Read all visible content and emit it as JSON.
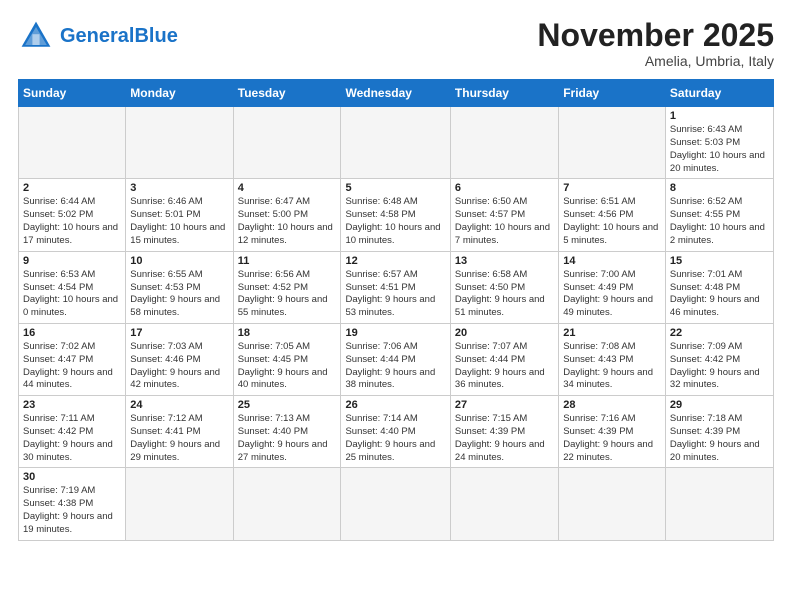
{
  "header": {
    "logo_general": "General",
    "logo_blue": "Blue",
    "month_title": "November 2025",
    "subtitle": "Amelia, Umbria, Italy"
  },
  "days_of_week": [
    "Sunday",
    "Monday",
    "Tuesday",
    "Wednesday",
    "Thursday",
    "Friday",
    "Saturday"
  ],
  "weeks": [
    [
      {
        "day": "",
        "info": ""
      },
      {
        "day": "",
        "info": ""
      },
      {
        "day": "",
        "info": ""
      },
      {
        "day": "",
        "info": ""
      },
      {
        "day": "",
        "info": ""
      },
      {
        "day": "",
        "info": ""
      },
      {
        "day": "1",
        "info": "Sunrise: 6:43 AM\nSunset: 5:03 PM\nDaylight: 10 hours and 20 minutes."
      }
    ],
    [
      {
        "day": "2",
        "info": "Sunrise: 6:44 AM\nSunset: 5:02 PM\nDaylight: 10 hours and 17 minutes."
      },
      {
        "day": "3",
        "info": "Sunrise: 6:46 AM\nSunset: 5:01 PM\nDaylight: 10 hours and 15 minutes."
      },
      {
        "day": "4",
        "info": "Sunrise: 6:47 AM\nSunset: 5:00 PM\nDaylight: 10 hours and 12 minutes."
      },
      {
        "day": "5",
        "info": "Sunrise: 6:48 AM\nSunset: 4:58 PM\nDaylight: 10 hours and 10 minutes."
      },
      {
        "day": "6",
        "info": "Sunrise: 6:50 AM\nSunset: 4:57 PM\nDaylight: 10 hours and 7 minutes."
      },
      {
        "day": "7",
        "info": "Sunrise: 6:51 AM\nSunset: 4:56 PM\nDaylight: 10 hours and 5 minutes."
      },
      {
        "day": "8",
        "info": "Sunrise: 6:52 AM\nSunset: 4:55 PM\nDaylight: 10 hours and 2 minutes."
      }
    ],
    [
      {
        "day": "9",
        "info": "Sunrise: 6:53 AM\nSunset: 4:54 PM\nDaylight: 10 hours and 0 minutes."
      },
      {
        "day": "10",
        "info": "Sunrise: 6:55 AM\nSunset: 4:53 PM\nDaylight: 9 hours and 58 minutes."
      },
      {
        "day": "11",
        "info": "Sunrise: 6:56 AM\nSunset: 4:52 PM\nDaylight: 9 hours and 55 minutes."
      },
      {
        "day": "12",
        "info": "Sunrise: 6:57 AM\nSunset: 4:51 PM\nDaylight: 9 hours and 53 minutes."
      },
      {
        "day": "13",
        "info": "Sunrise: 6:58 AM\nSunset: 4:50 PM\nDaylight: 9 hours and 51 minutes."
      },
      {
        "day": "14",
        "info": "Sunrise: 7:00 AM\nSunset: 4:49 PM\nDaylight: 9 hours and 49 minutes."
      },
      {
        "day": "15",
        "info": "Sunrise: 7:01 AM\nSunset: 4:48 PM\nDaylight: 9 hours and 46 minutes."
      }
    ],
    [
      {
        "day": "16",
        "info": "Sunrise: 7:02 AM\nSunset: 4:47 PM\nDaylight: 9 hours and 44 minutes."
      },
      {
        "day": "17",
        "info": "Sunrise: 7:03 AM\nSunset: 4:46 PM\nDaylight: 9 hours and 42 minutes."
      },
      {
        "day": "18",
        "info": "Sunrise: 7:05 AM\nSunset: 4:45 PM\nDaylight: 9 hours and 40 minutes."
      },
      {
        "day": "19",
        "info": "Sunrise: 7:06 AM\nSunset: 4:44 PM\nDaylight: 9 hours and 38 minutes."
      },
      {
        "day": "20",
        "info": "Sunrise: 7:07 AM\nSunset: 4:44 PM\nDaylight: 9 hours and 36 minutes."
      },
      {
        "day": "21",
        "info": "Sunrise: 7:08 AM\nSunset: 4:43 PM\nDaylight: 9 hours and 34 minutes."
      },
      {
        "day": "22",
        "info": "Sunrise: 7:09 AM\nSunset: 4:42 PM\nDaylight: 9 hours and 32 minutes."
      }
    ],
    [
      {
        "day": "23",
        "info": "Sunrise: 7:11 AM\nSunset: 4:42 PM\nDaylight: 9 hours and 30 minutes."
      },
      {
        "day": "24",
        "info": "Sunrise: 7:12 AM\nSunset: 4:41 PM\nDaylight: 9 hours and 29 minutes."
      },
      {
        "day": "25",
        "info": "Sunrise: 7:13 AM\nSunset: 4:40 PM\nDaylight: 9 hours and 27 minutes."
      },
      {
        "day": "26",
        "info": "Sunrise: 7:14 AM\nSunset: 4:40 PM\nDaylight: 9 hours and 25 minutes."
      },
      {
        "day": "27",
        "info": "Sunrise: 7:15 AM\nSunset: 4:39 PM\nDaylight: 9 hours and 24 minutes."
      },
      {
        "day": "28",
        "info": "Sunrise: 7:16 AM\nSunset: 4:39 PM\nDaylight: 9 hours and 22 minutes."
      },
      {
        "day": "29",
        "info": "Sunrise: 7:18 AM\nSunset: 4:39 PM\nDaylight: 9 hours and 20 minutes."
      }
    ],
    [
      {
        "day": "30",
        "info": "Sunrise: 7:19 AM\nSunset: 4:38 PM\nDaylight: 9 hours and 19 minutes."
      },
      {
        "day": "",
        "info": ""
      },
      {
        "day": "",
        "info": ""
      },
      {
        "day": "",
        "info": ""
      },
      {
        "day": "",
        "info": ""
      },
      {
        "day": "",
        "info": ""
      },
      {
        "day": "",
        "info": ""
      }
    ]
  ]
}
